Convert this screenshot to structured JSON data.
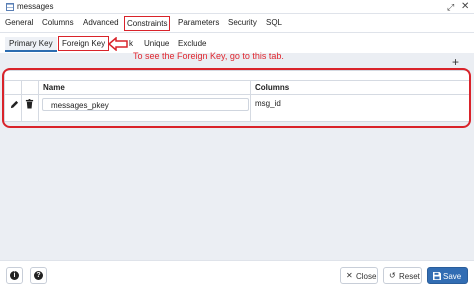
{
  "window": {
    "title": "messages",
    "icon": "table-icon",
    "expand_icon": "⤢",
    "close_icon": "✕"
  },
  "main_tabs": [
    {
      "label": "General"
    },
    {
      "label": "Columns"
    },
    {
      "label": "Advanced"
    },
    {
      "label": "Constraints",
      "active": true
    },
    {
      "label": "Parameters"
    },
    {
      "label": "Security"
    },
    {
      "label": "SQL"
    }
  ],
  "sub_tabs": [
    {
      "label": "Primary Key",
      "active": true
    },
    {
      "label": "Foreign Key"
    },
    {
      "label": "k"
    },
    {
      "label": "Unique"
    },
    {
      "label": "Exclude"
    }
  ],
  "annotation": {
    "text": "To see the Foreign Key, go to this tab.",
    "color": "#e0272f"
  },
  "toolbar": {
    "add_icon": "+"
  },
  "grid": {
    "headers": {
      "name": "Name",
      "columns": "Columns"
    },
    "rows": [
      {
        "name": "messages_pkey",
        "columns": "msg_id"
      }
    ]
  },
  "footer": {
    "info_icon": "i",
    "help_icon": "?",
    "close_label": "Close",
    "close_icon": "✕",
    "reset_label": "Reset",
    "reset_icon": "↺",
    "save_label": "Save",
    "save_icon": "save-icon"
  },
  "colors": {
    "accent": "#326db3",
    "highlight": "#d9232a"
  }
}
